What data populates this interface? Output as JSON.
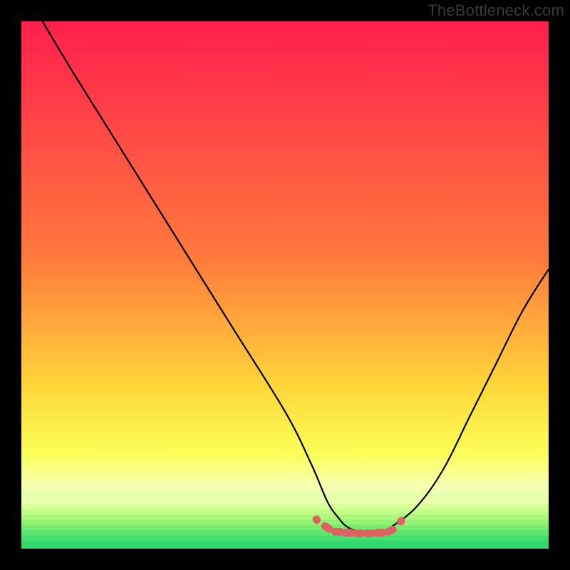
{
  "watermark": "TheBottleneck.com",
  "colors": {
    "background": "#000000",
    "gradient_top": "#ff1f4d",
    "gradient_mid_upper": "#ff7a3d",
    "gradient_mid": "#ffd93a",
    "gradient_lower": "#fbff58",
    "gradient_pale": "#f7ffb0",
    "gradient_green_light": "#98f77e",
    "gradient_green": "#2fe06f",
    "curve": "#000000",
    "marker": "#de6262"
  },
  "chart_data": {
    "type": "line",
    "title": "",
    "xlabel": "",
    "ylabel": "",
    "xlim": [
      0,
      100
    ],
    "ylim": [
      0,
      100
    ],
    "series": [
      {
        "name": "bottleneck-curve",
        "x": [
          4,
          10,
          20,
          30,
          40,
          50,
          55,
          58,
          60,
          62,
          65,
          68,
          70,
          75,
          80,
          85,
          90,
          95,
          100
        ],
        "values": [
          100,
          90,
          74,
          58,
          42,
          26,
          16,
          9,
          6,
          4,
          3,
          3,
          4,
          8,
          15,
          25,
          35,
          45,
          53
        ]
      }
    ],
    "markers": {
      "name": "bottom-marker",
      "x": [
        56,
        58,
        60,
        62,
        64,
        66,
        68,
        70,
        72
      ],
      "values": [
        5.5,
        4.0,
        3.2,
        3.0,
        2.9,
        2.9,
        3.0,
        3.4,
        5.2
      ]
    },
    "gradient_stops_pct": [
      0,
      45,
      70,
      82,
      88,
      92,
      96,
      100
    ]
  }
}
